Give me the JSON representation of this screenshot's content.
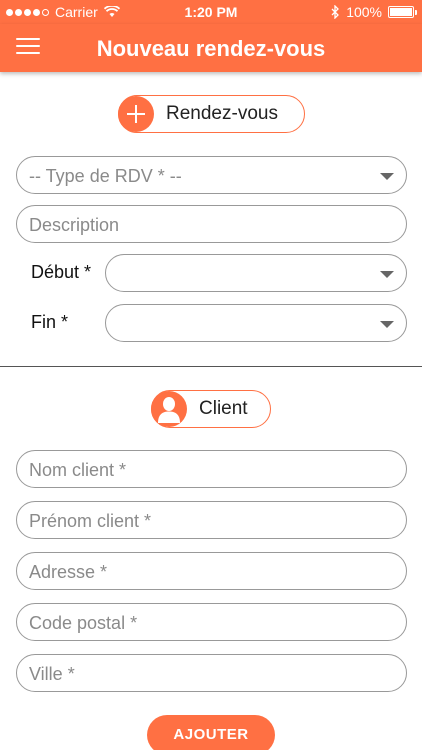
{
  "status_bar": {
    "carrier": "Carrier",
    "time": "1:20 PM",
    "battery": "100%"
  },
  "header": {
    "title": "Nouveau rendez-vous"
  },
  "appointment_section": {
    "label": "Rendez-vous",
    "type_select": "-- Type de RDV * --",
    "description_placeholder": "Description",
    "start_label": "Début *",
    "end_label": "Fin *"
  },
  "client_section": {
    "label": "Client",
    "fields": {
      "nom": "Nom client *",
      "prenom": "Prénom client *",
      "adresse": "Adresse *",
      "code_postal": "Code postal *",
      "ville": "Ville *"
    }
  },
  "submit_label": "AJOUTER",
  "colors": {
    "accent": "#ff7043"
  }
}
